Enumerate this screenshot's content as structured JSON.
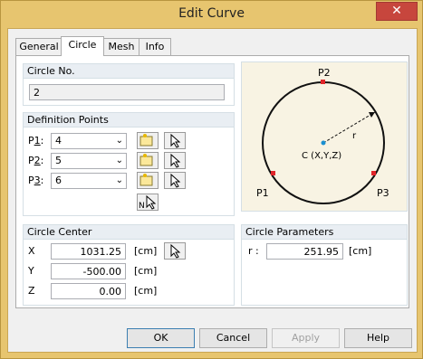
{
  "window": {
    "title": "Edit Curve",
    "close_glyph": "✕"
  },
  "tabs": [
    {
      "label": "General"
    },
    {
      "label": "Circle"
    },
    {
      "label": "Mesh"
    },
    {
      "label": "Info"
    }
  ],
  "circle_no": {
    "header": "Circle No.",
    "value": "2"
  },
  "definition_points": {
    "header": "Definition Points",
    "rows": [
      {
        "label_prefix": "P",
        "label_digit": "1",
        "label_suffix": ":",
        "value": "4"
      },
      {
        "label_prefix": "P",
        "label_digit": "2",
        "label_suffix": ":",
        "value": "5"
      },
      {
        "label_prefix": "P",
        "label_digit": "3",
        "label_suffix": ":",
        "value": "6"
      }
    ]
  },
  "diagram": {
    "top_label": "P2",
    "left_label": "P1",
    "right_label": "P3",
    "radius_label": "r",
    "center_label": "C (X,Y,Z)"
  },
  "circle_center": {
    "header": "Circle Center",
    "rows": [
      {
        "label": "X",
        "value": "1031.25",
        "unit": "[cm]"
      },
      {
        "label": "Y",
        "value": "-500.00",
        "unit": "[cm]"
      },
      {
        "label": "Z",
        "value": "0.00",
        "unit": "[cm]"
      }
    ]
  },
  "circle_parameters": {
    "header": "Circle Parameters",
    "label": "r :",
    "value": "251.95",
    "unit": "[cm]"
  },
  "buttons": {
    "ok": "OK",
    "cancel": "Cancel",
    "apply": "Apply",
    "help": "Help"
  },
  "icons": {
    "new_node_icon": "new-node-icon",
    "pick_icon": "pick-node-icon",
    "numbered_pick_icon": "pick-numbered-node-icon"
  }
}
